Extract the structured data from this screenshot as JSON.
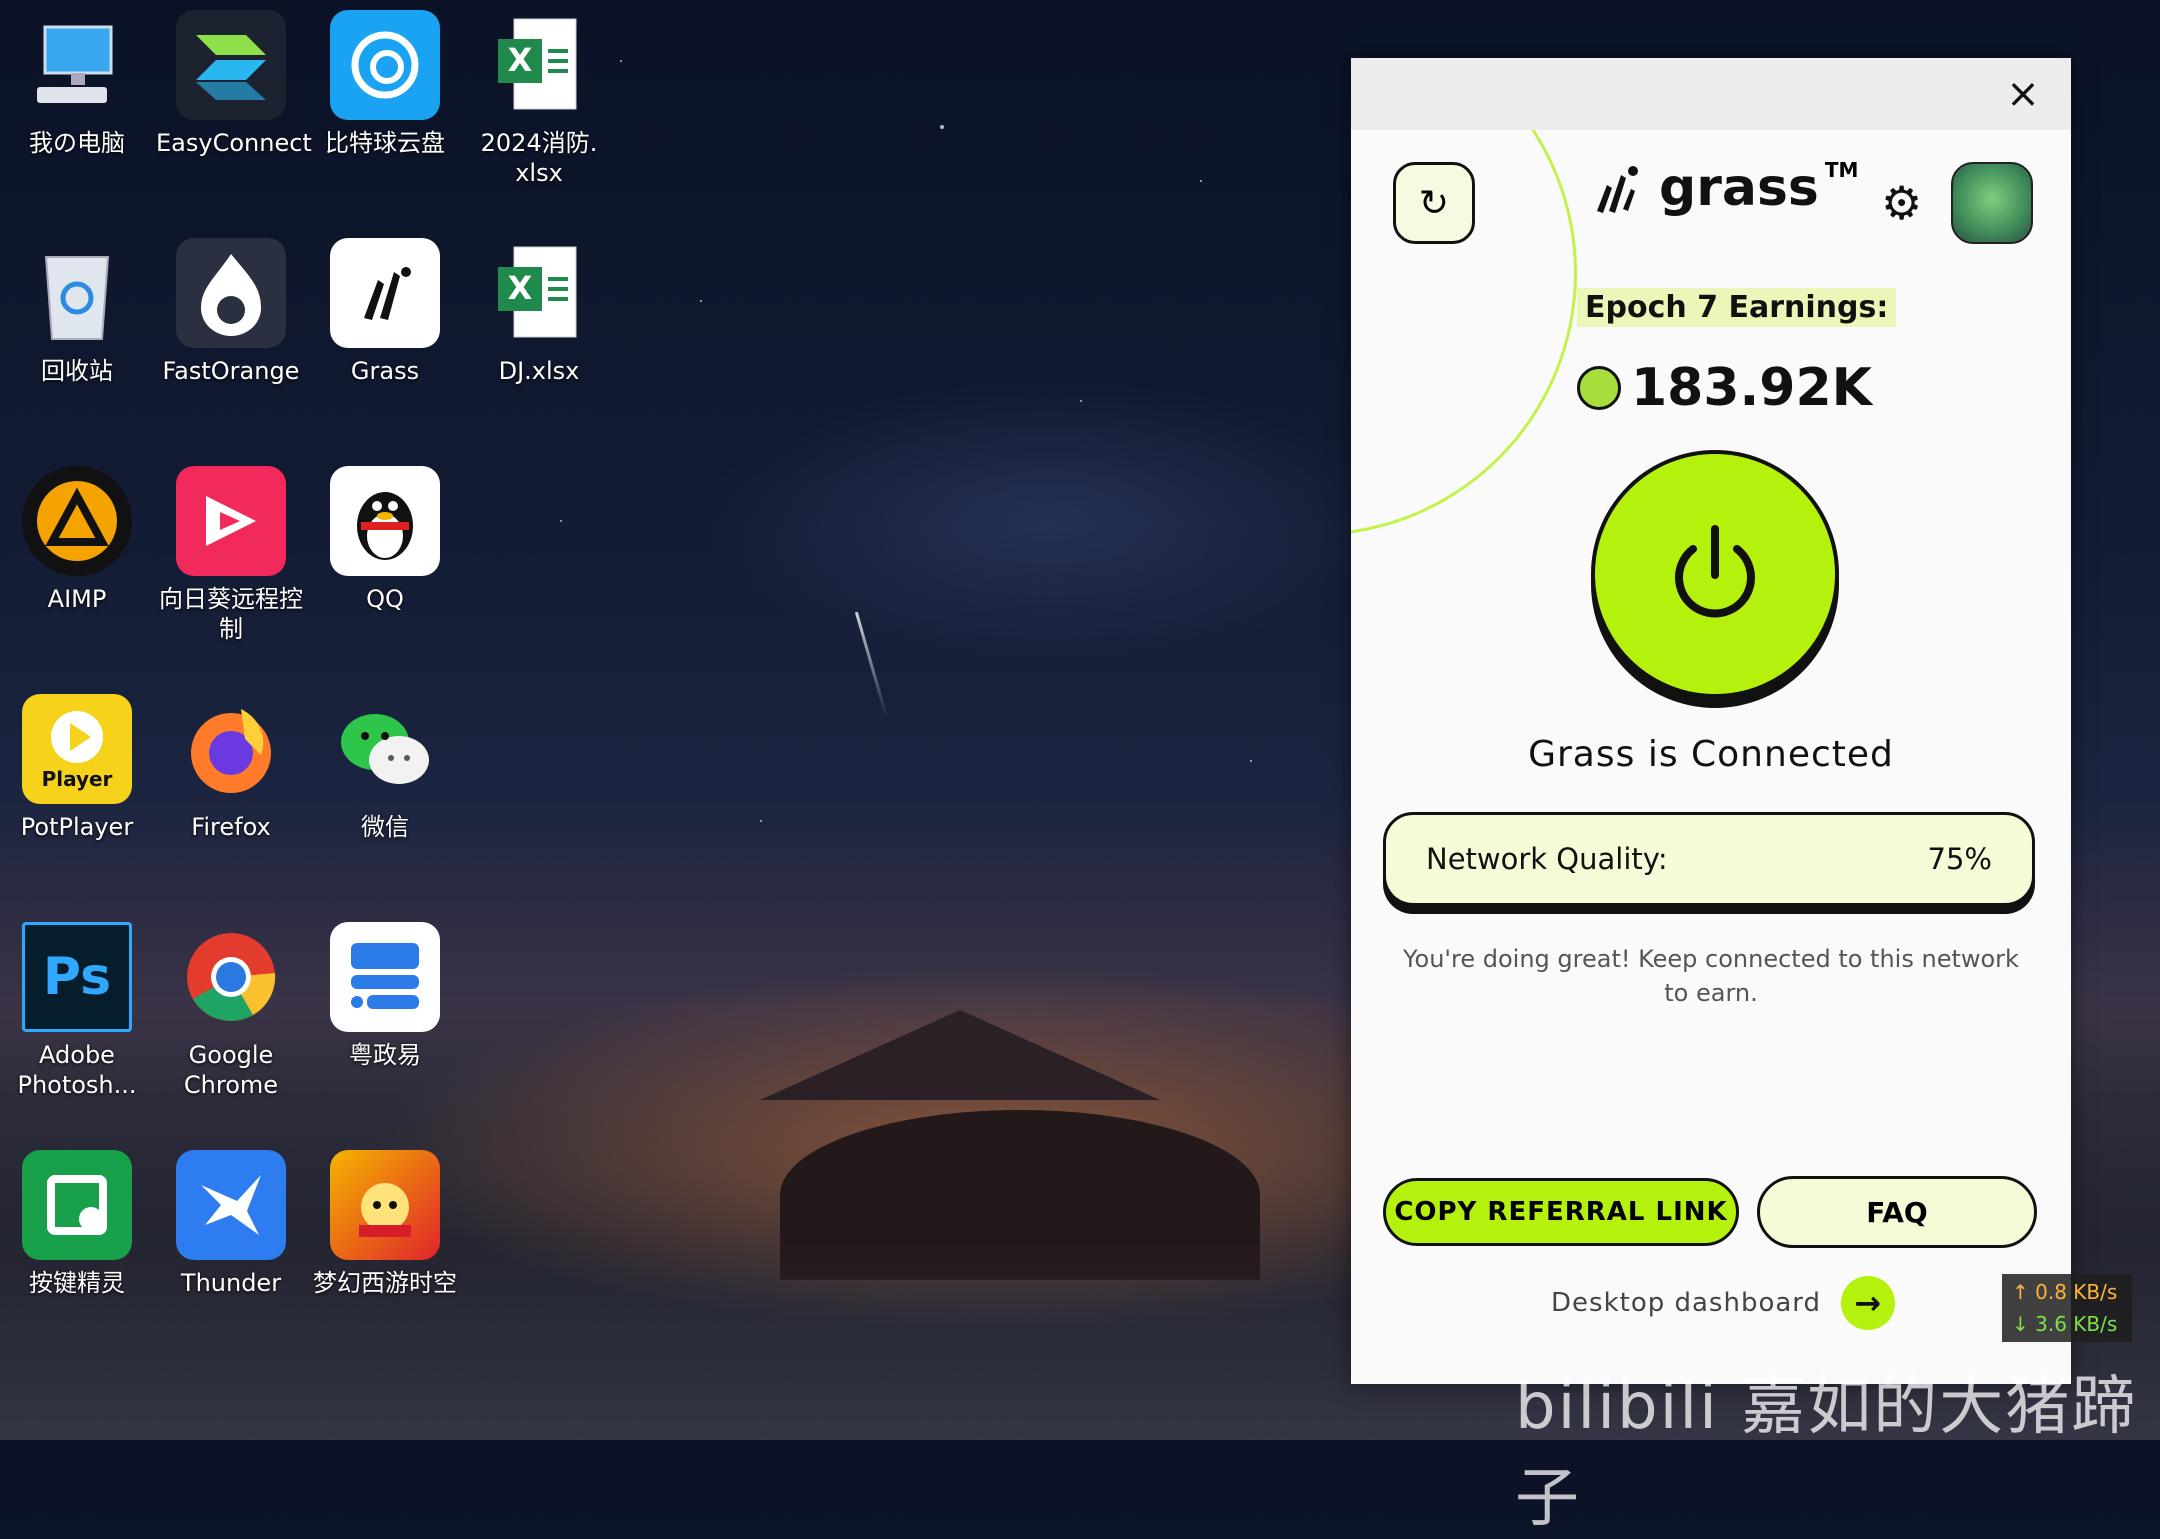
{
  "desktop": {
    "icons": [
      {
        "label": "我の电脑"
      },
      {
        "label": "EasyConnect"
      },
      {
        "label": "比特球云盘"
      },
      {
        "label": "2024消防.\nxlsx"
      },
      {
        "label": "回收站"
      },
      {
        "label": "FastOrange"
      },
      {
        "label": "Grass"
      },
      {
        "label": "DJ.xlsx"
      },
      {
        "label": "AIMP"
      },
      {
        "label": "向日葵远程控\n制"
      },
      {
        "label": "QQ"
      },
      {
        "label": "PotPlayer"
      },
      {
        "label": "Firefox"
      },
      {
        "label": "微信"
      },
      {
        "label": "Adobe\nPhotosh..."
      },
      {
        "label": "Google\nChrome"
      },
      {
        "label": "粤政易"
      },
      {
        "label": "按键精灵"
      },
      {
        "label": "Thunder"
      },
      {
        "label": "梦幻西游时空"
      }
    ],
    "icon_glyphs": {
      "potplayer": "Player",
      "photoshop": "Ps"
    }
  },
  "grass_window": {
    "close_glyph": "×",
    "refresh_glyph": "↻",
    "brand_word": "grass",
    "brand_tm": "TM",
    "gear_glyph": "⚙",
    "epoch_label": "Epoch 7 Earnings:",
    "earnings": "183.92K",
    "status": "Grass is Connected",
    "network_quality_label": "Network Quality:",
    "network_quality_value": "75%",
    "message": "You're doing great! Keep connected to this network to earn.",
    "copy_referral": "COPY REFERRAL LINK",
    "faq": "FAQ",
    "dashboard": "Desktop dashboard",
    "dashboard_arrow": "→",
    "accent": "#b4f20e"
  },
  "speed": {
    "up": "↑ 0.8 KB/s",
    "down": "↓ 3.6 KB/s"
  },
  "watermark": "bilibili 嘉如的大猪蹄子"
}
